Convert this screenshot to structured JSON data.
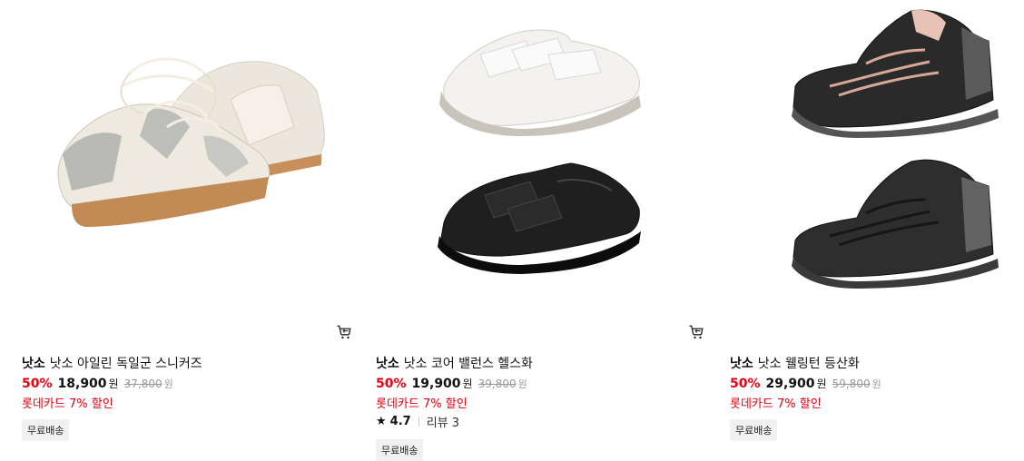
{
  "products": [
    {
      "brand": "낫소",
      "name": "낫소 아일린 독일군 스니커즈",
      "discount": "50%",
      "price": "18,900",
      "currency": "원",
      "original_price": "37,800",
      "card_promo": "롯데카드 7% 할인",
      "badge": "무료배송"
    },
    {
      "brand": "낫소",
      "name": "낫소 코어 밸런스 헬스화",
      "discount": "50%",
      "price": "19,900",
      "currency": "원",
      "original_price": "39,800",
      "card_promo": "롯데카드 7% 할인",
      "rating": "4.7",
      "review_label": "리뷰 3",
      "badge": "무료배송"
    },
    {
      "brand": "낫소",
      "name": "낫소 웰링턴 등산화",
      "discount": "50%",
      "price": "29,900",
      "currency": "원",
      "original_price": "59,800",
      "card_promo": "롯데카드 7% 할인",
      "badge": "무료배송"
    }
  ],
  "icons": {
    "cart": "cart-icon",
    "star": "star-icon"
  },
  "colors": {
    "discount": "#e60012",
    "badge_bg": "#f1f1f1"
  }
}
